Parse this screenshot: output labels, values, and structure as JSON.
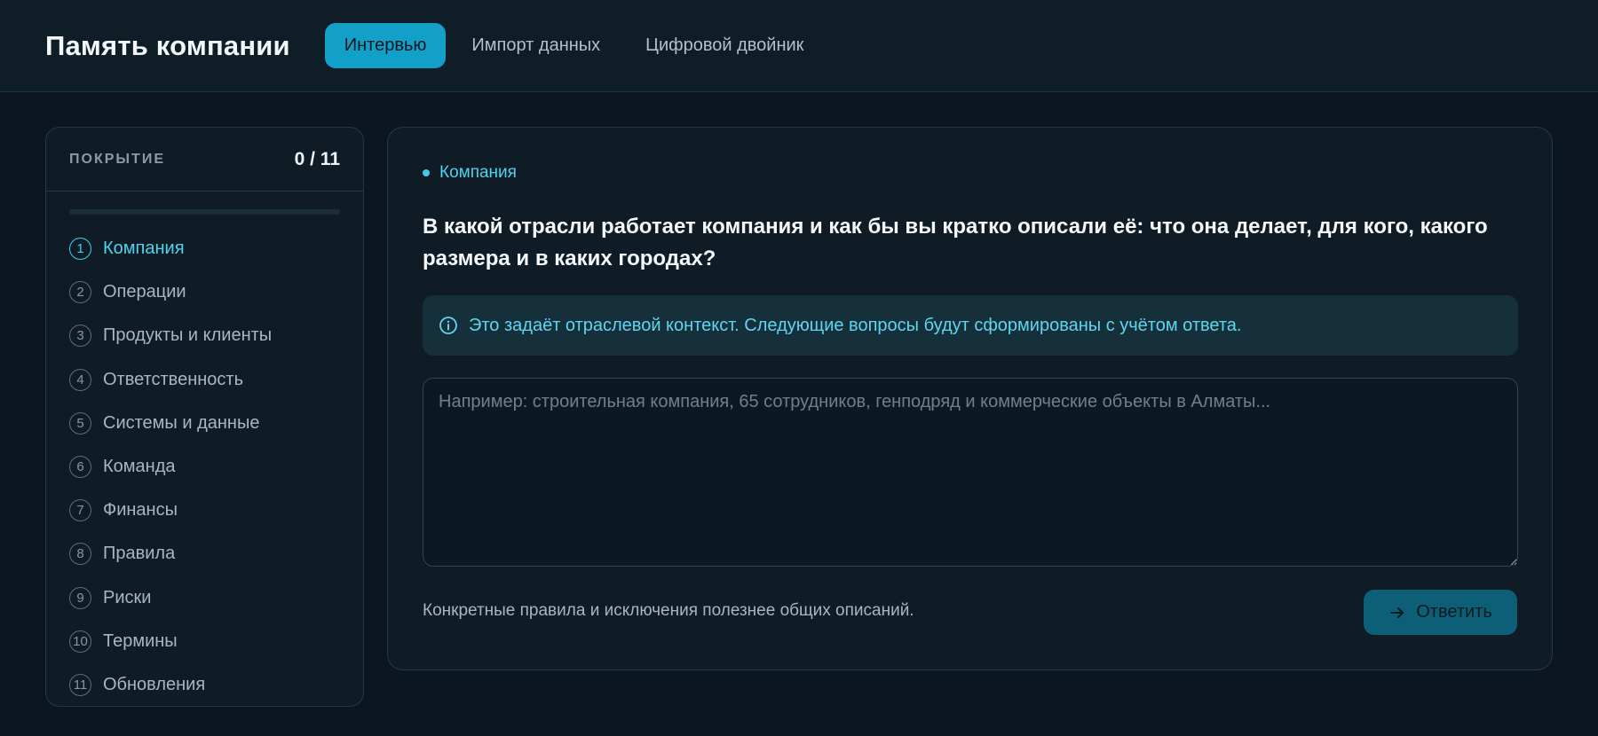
{
  "header": {
    "app_title": "Память компании",
    "tabs": [
      {
        "label": "Интервью",
        "active": true
      },
      {
        "label": "Импорт данных",
        "active": false
      },
      {
        "label": "Цифровой двойник",
        "active": false
      }
    ]
  },
  "sidebar": {
    "coverage_label": "ПОКРЫТИЕ",
    "coverage_count": "0 / 11",
    "progress": 0,
    "topics": [
      {
        "num": "1",
        "label": "Компания",
        "active": true
      },
      {
        "num": "2",
        "label": "Операции"
      },
      {
        "num": "3",
        "label": "Продукты и клиенты"
      },
      {
        "num": "4",
        "label": "Ответственность"
      },
      {
        "num": "5",
        "label": "Системы и данные"
      },
      {
        "num": "6",
        "label": "Команда"
      },
      {
        "num": "7",
        "label": "Финансы"
      },
      {
        "num": "8",
        "label": "Правила"
      },
      {
        "num": "9",
        "label": "Риски"
      },
      {
        "num": "10",
        "label": "Термины"
      },
      {
        "num": "11",
        "label": "Обновления"
      }
    ]
  },
  "main": {
    "section_tag": "Компания",
    "question": "В какой отрасли работает компания и как бы вы кратко описали её: что она делает, для кого, какого размера и в каких городах?",
    "hint": "Это задаёт отраслевой контекст. Следующие вопросы будут сформированы с учётом ответа.",
    "answer_placeholder": "Например: строительная компания, 65 сотрудников, генподряд и коммерческие объекты в Алматы...",
    "answer_value": "",
    "footer_note": "Конкретные правила и исключения полезнее общих описаний.",
    "submit_label": "Ответить"
  },
  "colors": {
    "accent": "#13a0c8",
    "accent_text": "#4ed3ef",
    "background": "#0b1620",
    "panel": "#0f1c26"
  },
  "icons": {
    "hint": "info-icon",
    "submit": "arrow-right-icon"
  }
}
